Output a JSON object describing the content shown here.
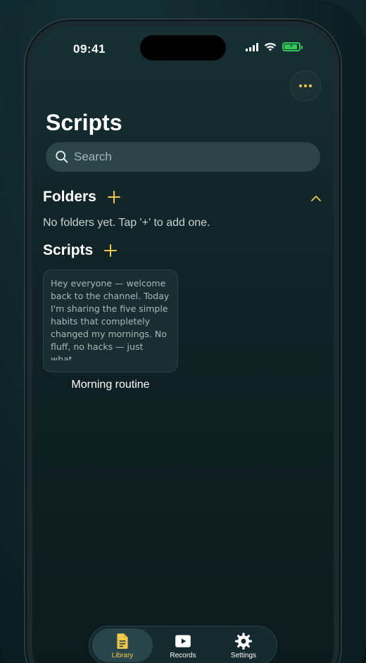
{
  "status_bar": {
    "time": "09:41"
  },
  "header": {
    "title": "Scripts",
    "more_icon": "ellipsis-icon"
  },
  "search": {
    "placeholder": "Search"
  },
  "folders": {
    "title": "Folders",
    "empty_message": "No folders yet. Tap '+' to add one."
  },
  "scripts": {
    "title": "Scripts",
    "items": [
      {
        "preview": "Hey everyone — welcome back to the channel. Today I'm sharing the five simple habits that completely changed my mornings. No fluff, no hacks — just what…",
        "name": "Morning routine"
      }
    ]
  },
  "tabs": [
    {
      "label": "Library",
      "icon": "document-icon",
      "active": true
    },
    {
      "label": "Records",
      "icon": "play-icon",
      "active": false
    },
    {
      "label": "Settings",
      "icon": "gear-icon",
      "active": false
    }
  ],
  "colors": {
    "accent": "#f2c94c",
    "battery": "#34c759"
  }
}
